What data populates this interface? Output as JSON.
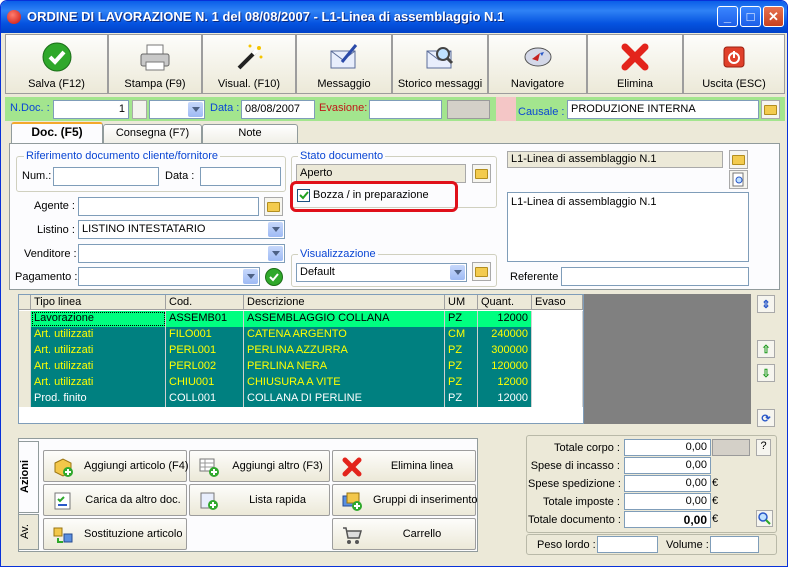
{
  "window": {
    "title": "ORDINE DI LAVORAZIONE N. 1  del 08/08/2007 - L1-Linea di assemblaggio N.1",
    "buttons": {
      "minimize": "_",
      "maximize": "□",
      "close": "✕"
    }
  },
  "toolbar": [
    {
      "id": "salva",
      "label": "Salva (F12)",
      "icon": "checkmark-icon"
    },
    {
      "id": "stampa",
      "label": "Stampa (F9)",
      "icon": "printer-icon"
    },
    {
      "id": "visual",
      "label": "Visual. (F10)",
      "icon": "magic-wand-icon"
    },
    {
      "id": "messaggio",
      "label": "Messaggio",
      "icon": "envelope-pen-icon"
    },
    {
      "id": "storico",
      "label": "Storico messaggi",
      "icon": "envelope-search-icon"
    },
    {
      "id": "navigatore",
      "label": "Navigatore",
      "icon": "compass-icon"
    },
    {
      "id": "elimina",
      "label": "Elimina",
      "icon": "red-x-icon"
    },
    {
      "id": "uscita",
      "label": "Uscita (ESC)",
      "icon": "power-icon"
    }
  ],
  "header": {
    "ndoc_label": "N.Doc. :",
    "ndoc_value": "1",
    "data_label": "Data :",
    "data_value": "08/08/2007",
    "evasione_label": "Evasione:",
    "evasione_value": "",
    "causale_label": "Causale :",
    "causale_value": "PRODUZIONE INTERNA"
  },
  "tabs": [
    {
      "label": "Doc. (F5)",
      "active": true
    },
    {
      "label": "Consegna (F7)",
      "active": false
    },
    {
      "label": "Note",
      "active": false
    }
  ],
  "doc": {
    "rif_group": "Riferimento documento cliente/fornitore",
    "num_label": "Num.:",
    "num_value": "",
    "data_label": "Data :",
    "data_value": "",
    "stato_group": "Stato documento",
    "stato_value": "Aperto",
    "bozza_label": "Bozza / in preparazione",
    "bozza_checked": true,
    "agente_label": "Agente :",
    "agente_value": "",
    "listino_label": "Listino :",
    "listino_value": "LISTINO INTESTATARIO",
    "venditore_label": "Venditore :",
    "venditore_value": "",
    "pagamento_label": "Pagamento :",
    "pagamento_value": "",
    "visual_group": "Visualizzazione",
    "visual_value": "Default",
    "linea_value": "L1-Linea di assemblaggio N.1",
    "linea_desc": "L1-Linea di assemblaggio N.1",
    "referente_label": "Referente",
    "referente_value": ""
  },
  "grid": {
    "columns": [
      "Tipo linea",
      "Cod.",
      "Descrizione",
      "UM",
      "Quant.",
      "Evaso"
    ],
    "rows": [
      {
        "tipo": "Lavorazione",
        "cod": "ASSEMB01",
        "desc": "ASSEMBLAGGIO COLLANA",
        "um": "PZ",
        "quant": "12000",
        "evaso": "",
        "style": "green"
      },
      {
        "tipo": "Art. utilizzati",
        "cod": "FILO001",
        "desc": "CATENA ARGENTO",
        "um": "CM",
        "quant": "240000",
        "evaso": "",
        "style": "teal-yellow"
      },
      {
        "tipo": "Art. utilizzati",
        "cod": "PERL001",
        "desc": "PERLINA AZZURRA",
        "um": "PZ",
        "quant": "300000",
        "evaso": "",
        "style": "teal-yellow"
      },
      {
        "tipo": "Art. utilizzati",
        "cod": "PERL002",
        "desc": "PERLINA NERA",
        "um": "PZ",
        "quant": "120000",
        "evaso": "",
        "style": "teal-yellow"
      },
      {
        "tipo": "Art. utilizzati",
        "cod": "CHIU001",
        "desc": "CHIUSURA A VITE",
        "um": "PZ",
        "quant": "12000",
        "evaso": "",
        "style": "teal-yellow"
      },
      {
        "tipo": "Prod. finito",
        "cod": "COLL001",
        "desc": "COLLANA DI PERLINE",
        "um": "PZ",
        "quant": "12000",
        "evaso": "",
        "style": "teal-white"
      }
    ]
  },
  "actions": {
    "vtab_azioni": "Azioni",
    "vtab_av": "Av.",
    "buttons": [
      {
        "label": "Aggiungi articolo (F4)",
        "icon": "add-box-icon"
      },
      {
        "label": "Aggiungi altro (F3)",
        "icon": "add-grid-icon"
      },
      {
        "label": "Elimina linea",
        "icon": "red-x-icon"
      },
      {
        "label": "Carica da altro doc.",
        "icon": "checklist-icon"
      },
      {
        "label": "Lista rapida",
        "icon": "add-list-icon"
      },
      {
        "label": "Gruppi di inserimento",
        "icon": "group-add-icon"
      },
      {
        "label": "Sostituzione articolo",
        "icon": "swap-icon"
      },
      {
        "label": "Carrello",
        "icon": "cart-icon"
      }
    ]
  },
  "totals": {
    "corpo_label": "Totale corpo :",
    "corpo_value": "0,00",
    "help": "?",
    "incasso_label": "Spese di incasso :",
    "incasso_value": "0,00",
    "spedizione_label": "Spese spedizione :",
    "spedizione_value": "0,00",
    "imposte_label": "Totale imposte :",
    "imposte_value": "0,00",
    "documento_label": "Totale documento :",
    "documento_value": "0,00",
    "currency": "€",
    "peso_label": "Peso lordo :",
    "peso_value": "",
    "volume_label": "Volume :",
    "volume_value": ""
  },
  "colors": {
    "highlight_red": "#e0101a",
    "row_green": "#00ff80",
    "row_teal": "#008080",
    "row_yellow": "#ffff00"
  }
}
